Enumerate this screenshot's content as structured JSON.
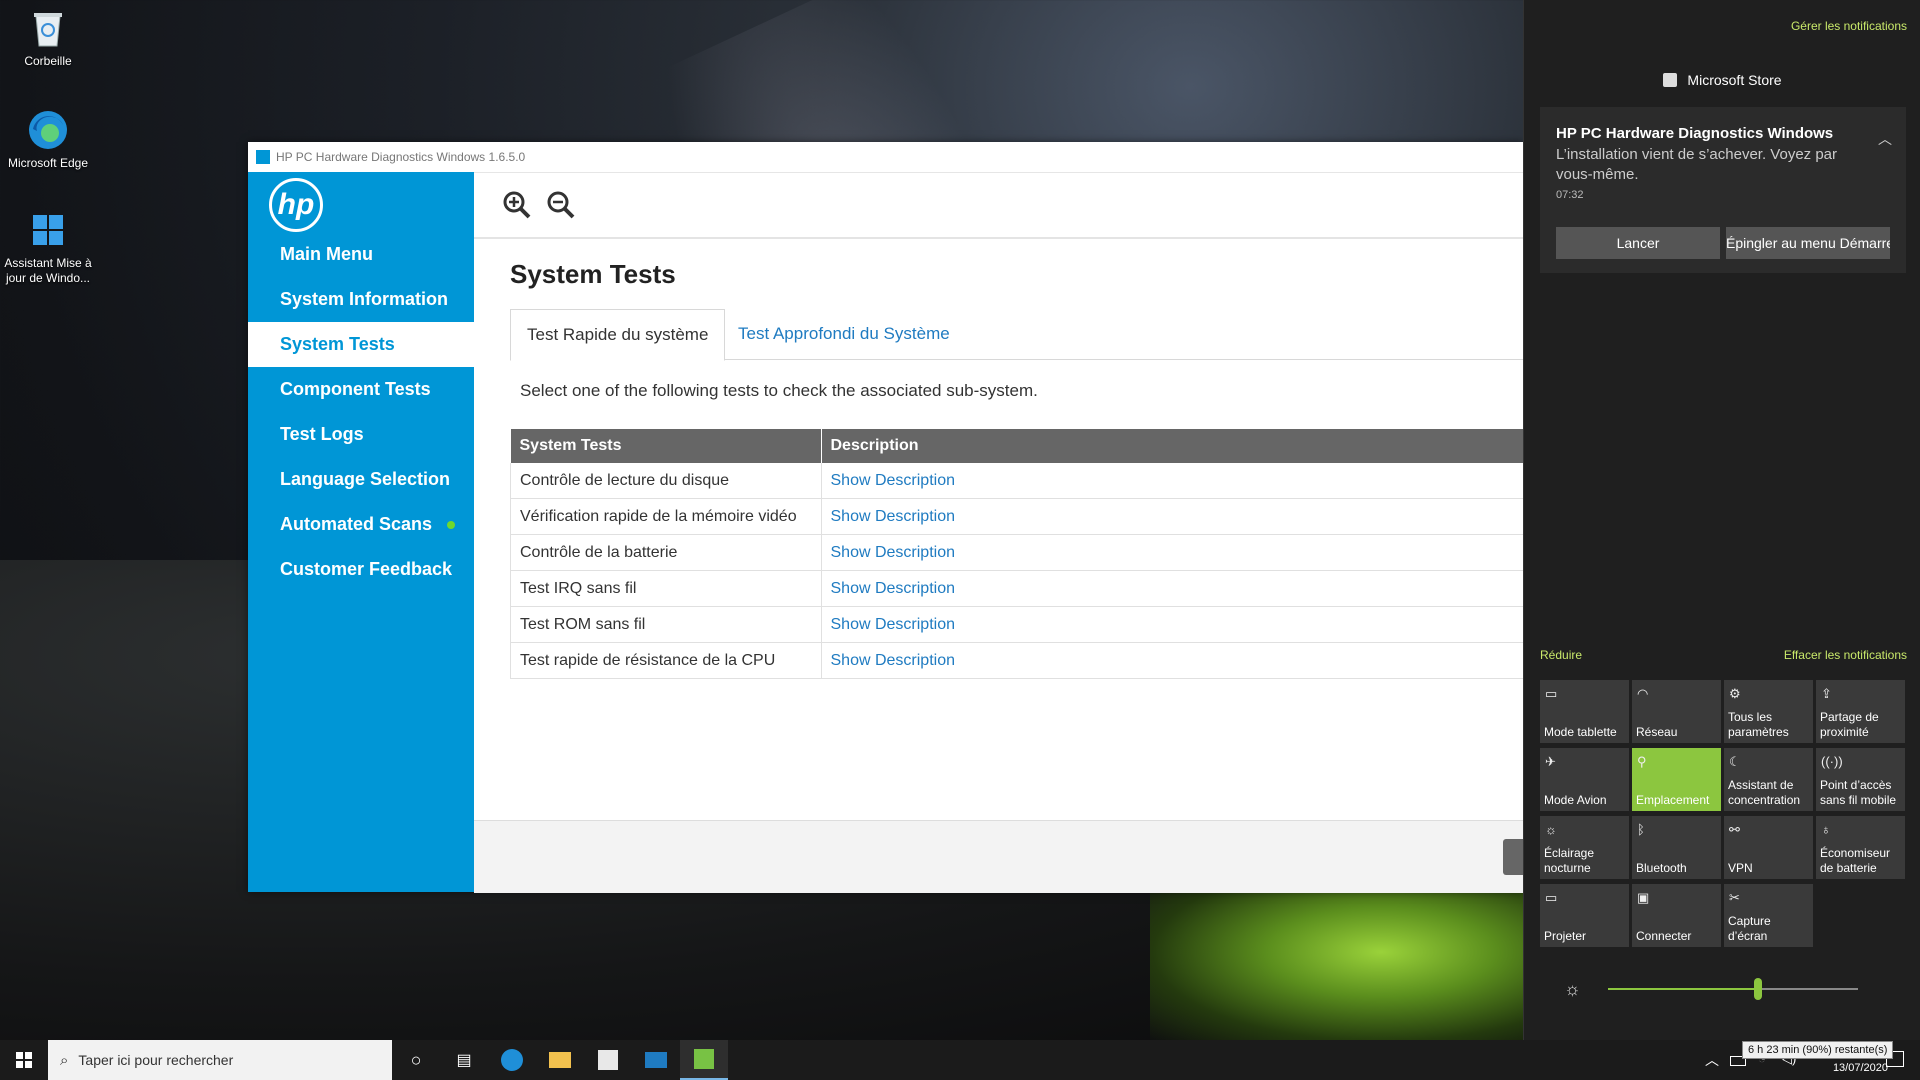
{
  "desktop": {
    "icons": [
      {
        "label": "Corbeille"
      },
      {
        "label": "Microsoft Edge"
      },
      {
        "label": "Assistant Mise à jour de Windo..."
      }
    ]
  },
  "window": {
    "title": "HP PC Hardware Diagnostics Windows 1.6.5.0",
    "logo": "hp",
    "nav": [
      {
        "label": "Main Menu"
      },
      {
        "label": "System Information"
      },
      {
        "label": "System Tests"
      },
      {
        "label": "Component Tests"
      },
      {
        "label": "Test Logs"
      },
      {
        "label": "Language Selection"
      },
      {
        "label": "Automated Scans"
      },
      {
        "label": "Customer Feedback"
      }
    ],
    "active_nav": "System Tests",
    "page_title": "System Tests",
    "tabs": [
      {
        "label": "Test Rapide du système"
      },
      {
        "label": "Test Approfondi du Système"
      }
    ],
    "subtitle": "Select one of the following tests to check the associated sub-system.",
    "table": {
      "headers": [
        "System Tests",
        "Description"
      ],
      "rows": [
        {
          "test": "Contrôle de lecture du disque",
          "link": "Show Description"
        },
        {
          "test": "Vérification rapide de la mémoire vidéo",
          "link": "Show Description"
        },
        {
          "test": "Contrôle de la batterie",
          "link": "Show Description"
        },
        {
          "test": "Test IRQ sans fil",
          "link": "Show Description"
        },
        {
          "test": "Test ROM sans fil",
          "link": "Show Description"
        },
        {
          "test": "Test rapide de résistance de la CPU",
          "link": "Show Description"
        }
      ]
    }
  },
  "action_center": {
    "manage_link": "Gérer les notifications",
    "app_name": "Microsoft Store",
    "notification": {
      "title": "HP PC Hardware Diagnostics Windows",
      "body": "L’installation vient de s’achever. Voyez par vous-même.",
      "time": "07:32",
      "btn_launch": "Lancer",
      "btn_pin": "Épingler au menu Démarrer"
    },
    "collapse_link": "Réduire",
    "clear_link": "Effacer les notifications",
    "tiles": [
      {
        "label": "Mode tablette",
        "icon": "tablet-icon",
        "on": false
      },
      {
        "label": "Réseau",
        "icon": "network-icon",
        "on": false
      },
      {
        "label": "Tous les paramètres",
        "icon": "gear-icon",
        "on": false
      },
      {
        "label": "Partage de proximité",
        "icon": "share-icon",
        "on": false
      },
      {
        "label": "Mode Avion",
        "icon": "airplane-icon",
        "on": false
      },
      {
        "label": "Emplacement",
        "icon": "location-icon",
        "on": true
      },
      {
        "label": "Assistant de concentration",
        "icon": "moon-icon",
        "on": false
      },
      {
        "label": "Point d’accès sans fil mobile",
        "icon": "hotspot-icon",
        "on": false
      },
      {
        "label": "Éclairage nocturne",
        "icon": "sun-icon",
        "on": false
      },
      {
        "label": "Bluetooth",
        "icon": "bluetooth-icon",
        "on": false
      },
      {
        "label": "VPN",
        "icon": "vpn-icon",
        "on": false
      },
      {
        "label": "Économiseur de batterie",
        "icon": "battery-saver-icon",
        "on": false
      },
      {
        "label": "Projeter",
        "icon": "project-icon",
        "on": false
      },
      {
        "label": "Connecter",
        "icon": "connect-icon",
        "on": false
      },
      {
        "label": "Capture d’écran",
        "icon": "snip-icon",
        "on": false
      }
    ],
    "brightness_fraction": 0.6,
    "accent": "#8cc63f"
  },
  "taskbar": {
    "search_placeholder": "Taper ici pour rechercher",
    "battery_tooltip": "6 h 23 min (90%) restante(s)",
    "date": "13/07/2020"
  }
}
